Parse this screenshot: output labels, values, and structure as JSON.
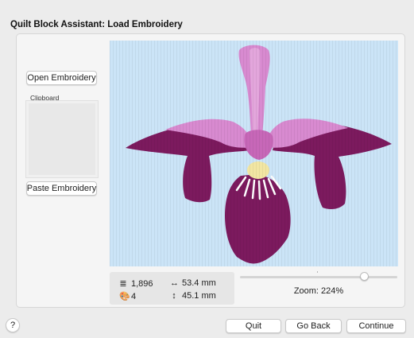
{
  "window": {
    "title": "Quilt Block Assistant: Load Embroidery"
  },
  "left_panel": {
    "open_label": "Open Embroidery",
    "clipboard_label": "Clipboard",
    "paste_label": "Paste Embroidery"
  },
  "preview": {
    "background_color": "#cbe4f7",
    "thread_colors": [
      "#7c1a5e",
      "#d88ad0",
      "#f2e6a3",
      "#ffffff"
    ]
  },
  "stats": {
    "stitches": "1,896",
    "colors": "4",
    "width": "53.4 mm",
    "height": "45.1 mm",
    "stitches_icon": "stitch-lines-icon",
    "colors_icon": "palette-icon",
    "width_icon": "horizontal-arrow-icon",
    "height_icon": "vertical-arrow-icon"
  },
  "zoom": {
    "label": "Zoom: 224%",
    "slider_fraction": 0.79
  },
  "footer": {
    "help_label": "?",
    "quit_label": "Quit",
    "back_label": "Go Back",
    "continue_label": "Continue"
  }
}
